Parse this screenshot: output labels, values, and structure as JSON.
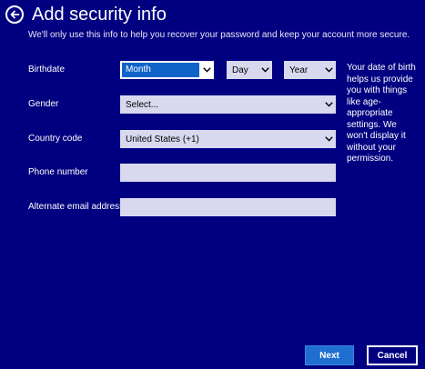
{
  "header": {
    "title": "Add security info",
    "back_icon": "back-arrow-icon"
  },
  "subtitle": "We'll only use this info to help you recover your password and keep your account more secure.",
  "form": {
    "birthdate": {
      "label": "Birthdate",
      "month": "Month",
      "day": "Day",
      "year": "Year"
    },
    "gender": {
      "label": "Gender",
      "value": "Select..."
    },
    "country_code": {
      "label": "Country code",
      "value": "United States (+1)"
    },
    "phone": {
      "label": "Phone number",
      "value": ""
    },
    "alt_email": {
      "label": "Alternate email address",
      "value": ""
    }
  },
  "help_text": "Your date of birth helps us provide you with things like age-appropriate settings. We won't display it without your permission.",
  "buttons": {
    "next": "Next",
    "cancel": "Cancel"
  },
  "colors": {
    "background": "#000080",
    "field": "#d8d8ef",
    "accent": "#1f6fd1",
    "focus_highlight": "#1064c8"
  }
}
